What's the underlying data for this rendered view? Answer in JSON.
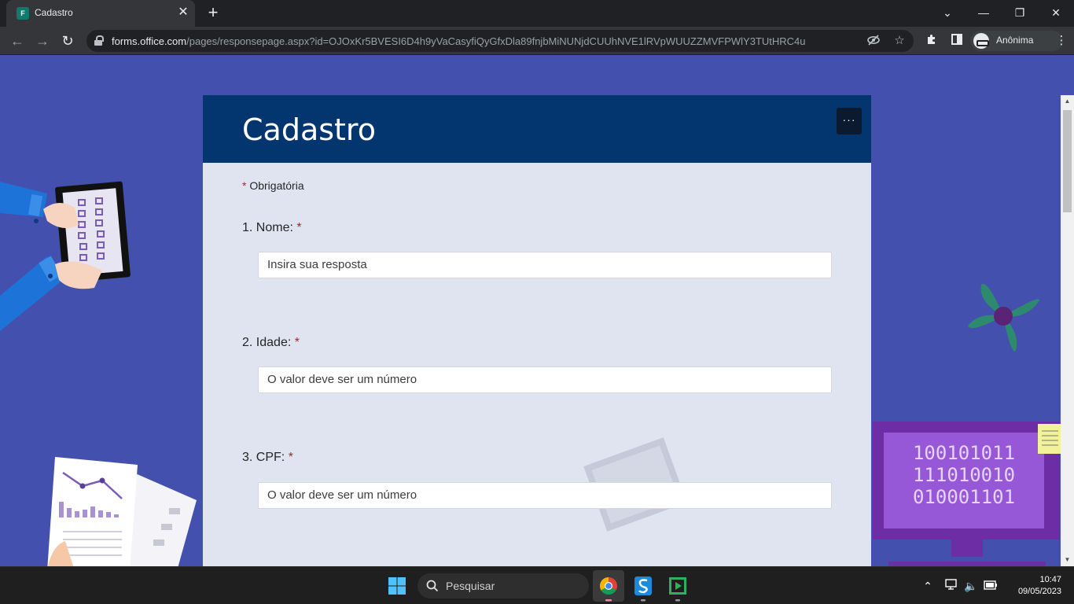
{
  "browser": {
    "tab_title": "Cadastro",
    "tab_favicon_text": "F",
    "url_domain": "forms.office.com",
    "url_path": "/pages/responsepage.aspx?id=OJOxKr5BVESI6D4h9yVaCasyfiQyGfxDla89fnjbMiNUNjdCUUhNVE1lRVpWUUZZMVFPWlY3TUtHRC4u",
    "profile_label": "Anônima"
  },
  "form": {
    "title": "Cadastro",
    "more_label": "···",
    "required_star": "*",
    "required_note": "Obrigatória",
    "questions": [
      {
        "number": "1.",
        "label": "Nome:",
        "placeholder": "Insira sua resposta"
      },
      {
        "number": "2.",
        "label": "Idade:",
        "placeholder": "O valor deve ser um número"
      },
      {
        "number": "3.",
        "label": "CPF:",
        "placeholder": "O valor deve ser um número"
      }
    ]
  },
  "decor": {
    "binary_rows": [
      "100101011",
      "111010010",
      "010001101"
    ]
  },
  "taskbar": {
    "search_label": "Pesquisar",
    "time": "10:47",
    "date": "09/05/2023"
  },
  "colors": {
    "page_bg": "#4350ad",
    "header_bg": "#03356e",
    "card_bg": "#e0e4f1",
    "required": "#a4262c"
  }
}
